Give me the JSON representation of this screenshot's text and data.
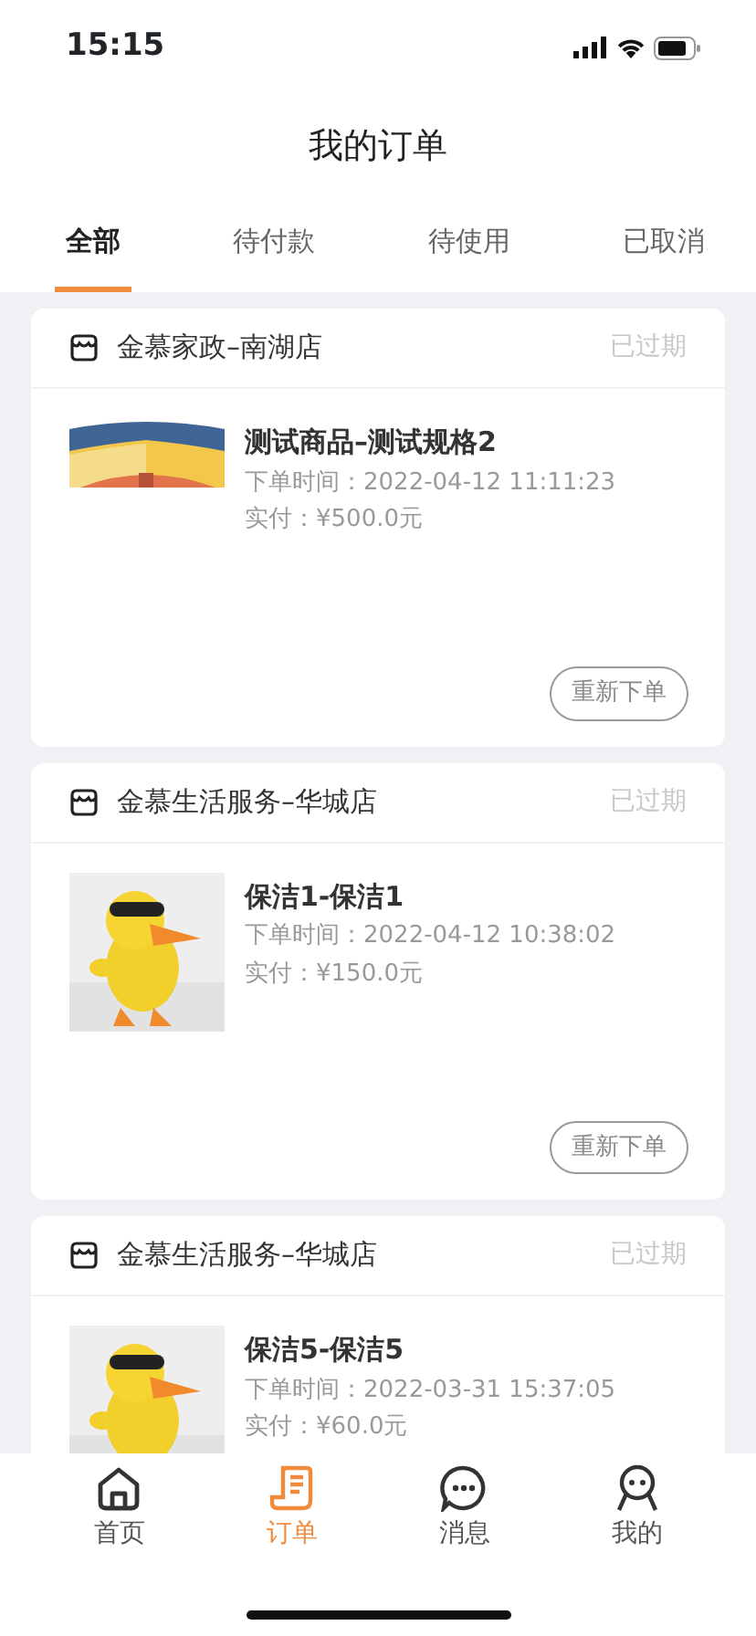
{
  "status_bar": {
    "time": "15:15"
  },
  "title": "我的订单",
  "tabs": [
    {
      "label": "全部",
      "selected": true
    },
    {
      "label": "待付款",
      "selected": false
    },
    {
      "label": "待使用",
      "selected": false
    },
    {
      "label": "已取消",
      "selected": false
    }
  ],
  "orders": [
    {
      "store": "金慕家政–南湖店",
      "status": "已过期",
      "product": "测试商品–测试规格2",
      "time": "下单时间：2022-04-12 11:11:23",
      "paid": "实付：¥500.0元",
      "button": "重新下单"
    },
    {
      "store": "金慕生活服务–华城店",
      "status": "已过期",
      "product": "保洁1-保洁1",
      "time": "下单时间：2022-04-12 10:38:02",
      "paid": "实付：¥150.0元",
      "button": "重新下单"
    },
    {
      "store": "金慕生活服务–华城店",
      "status": "已过期",
      "product": "保洁5-保洁5",
      "time": "下单时间：2022-03-31 15:37:05",
      "paid": "实付：¥60.0元"
    }
  ],
  "bottom_nav": [
    {
      "kind": "home",
      "label": "首页",
      "selected": false
    },
    {
      "kind": "orders",
      "label": "订单",
      "selected": true
    },
    {
      "kind": "messages",
      "label": "消息",
      "selected": false
    },
    {
      "kind": "profile",
      "label": "我的",
      "selected": false
    }
  ]
}
